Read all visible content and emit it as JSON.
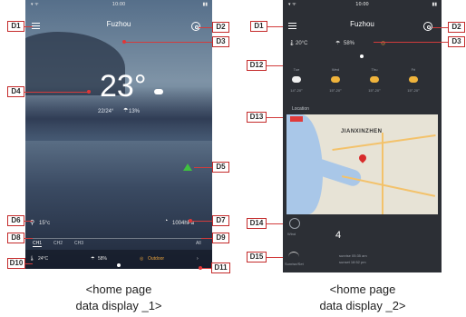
{
  "screen1": {
    "status_time": "10:00",
    "city": "Fuzhou",
    "temperature": "23°",
    "temp_range": "22/24°",
    "humidity": "13%",
    "indoor_temp": "15°c",
    "pressure": "1004hPa",
    "tabs": [
      "CH1",
      "CH2",
      "CH3"
    ],
    "tabs_right": "All",
    "bottom_temp": "24°C",
    "bottom_humidity": "58%",
    "bottom_label": "Outdoor",
    "caption_line1": "<home page",
    "caption_line2": "data display _1>"
  },
  "screen2": {
    "status_time": "10:00",
    "city": "Fuzhou",
    "temp": "20°C",
    "humidity": "58%",
    "forecast": [
      {
        "day": "Tue",
        "range": "14°-20°"
      },
      {
        "day": "Wed",
        "range": "15°-20°"
      },
      {
        "day": "Thu",
        "range": "15°-20°"
      },
      {
        "day": "Fri",
        "range": "15°-20°"
      }
    ],
    "map_header": "Location",
    "map_city": "JIANXINZHEN",
    "wind_label": "Wind",
    "wind_value": "4",
    "sun_label": "Sunrise/Set",
    "sunrise_text": "sunrise 05:35 am",
    "sunset_text": "sunset 18:52 pm",
    "caption_line1": "<home page",
    "caption_line2": "data display _2>"
  },
  "callouts": {
    "d1": "D1",
    "d2": "D2",
    "d3": "D3",
    "d4": "D4",
    "d5": "D5",
    "d6": "D6",
    "d7": "D7",
    "d8": "D8",
    "d9": "D9",
    "d10": "D10",
    "d11": "D11",
    "d12": "D12",
    "d13": "D13",
    "d14": "D14",
    "d15": "D15"
  },
  "colors": {
    "callout_border": "#c42b2b",
    "leader": "#d23c3c",
    "warning": "#3fc03f",
    "map_pin": "#d82b2b"
  }
}
